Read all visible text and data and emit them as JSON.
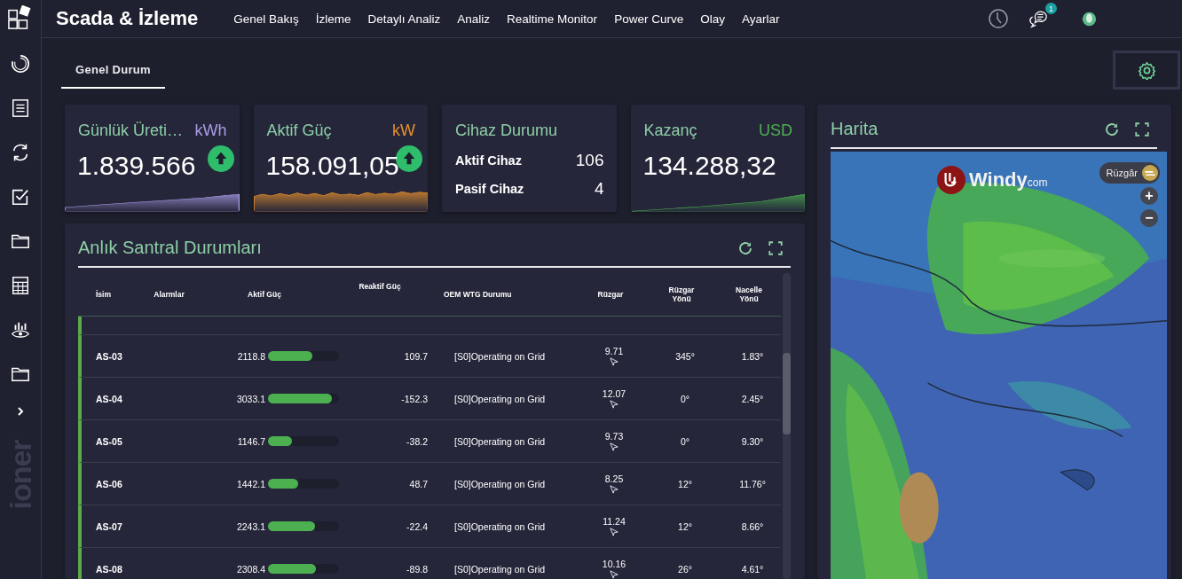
{
  "app": {
    "title": "Scada & İzleme",
    "brand": "ioner"
  },
  "nav": [
    {
      "label": "Genel Bakış"
    },
    {
      "label": "İzleme"
    },
    {
      "label": "Detaylı Analiz"
    },
    {
      "label": "Analiz"
    },
    {
      "label": "Realtime Monitor"
    },
    {
      "label": "Power Curve"
    },
    {
      "label": "Olay"
    },
    {
      "label": "Ayarlar"
    }
  ],
  "header": {
    "notification_count": "1"
  },
  "tabs": [
    {
      "label": "Genel Durum",
      "selected": true
    }
  ],
  "kpis": [
    {
      "kind": "metric",
      "title": "Günlük Üreti…",
      "unit": "kWh",
      "color": "#a99ce6",
      "value": "1.839.566",
      "trend_badge": true
    },
    {
      "kind": "metric",
      "title": "Aktif Güç",
      "unit": "kW",
      "color": "#e8912c",
      "value": "158.091,05",
      "trend_badge": true
    },
    {
      "kind": "devices",
      "title": "Cihaz Durumu",
      "rows": [
        {
          "label": "Aktif Cihaz",
          "value": "106"
        },
        {
          "label": "Pasif Cihaz",
          "value": "4"
        }
      ]
    },
    {
      "kind": "metric",
      "title": "Kazanç",
      "unit": "USD",
      "color": "#4caf50",
      "value": "134.288,32",
      "trend_badge": false
    }
  ],
  "table": {
    "title": "Anlık Santral Durumları",
    "columns": [
      "İsim",
      "Alarmlar",
      "Aktif Güç",
      "Reaktif Güç",
      "OEM WTG Durumu",
      "Rüzgar",
      "Rüzgar Yönü",
      "Nacelle Yönü"
    ],
    "rows": [
      {
        "name": "AS-03",
        "active_power": "2118.8",
        "level": 0.62,
        "reactive_power": "109.7",
        "status": "[S0]Operating on Grid",
        "wind": "9.71",
        "wind_direction": "345°",
        "nacelle_direction": "1.83°"
      },
      {
        "name": "AS-04",
        "active_power": "3033.1",
        "level": 0.9,
        "reactive_power": "-152.3",
        "status": "[S0]Operating on Grid",
        "wind": "12.07",
        "wind_direction": "0°",
        "nacelle_direction": "2.45°"
      },
      {
        "name": "AS-05",
        "active_power": "1146.7",
        "level": 0.34,
        "reactive_power": "-38.2",
        "status": "[S0]Operating on Grid",
        "wind": "9.73",
        "wind_direction": "0°",
        "nacelle_direction": "9.30°"
      },
      {
        "name": "AS-06",
        "active_power": "1442.1",
        "level": 0.43,
        "reactive_power": "48.7",
        "status": "[S0]Operating on Grid",
        "wind": "8.25",
        "wind_direction": "12°",
        "nacelle_direction": "11.76°"
      },
      {
        "name": "AS-07",
        "active_power": "2243.1",
        "level": 0.66,
        "reactive_power": "-22.4",
        "status": "[S0]Operating on Grid",
        "wind": "11.24",
        "wind_direction": "12°",
        "nacelle_direction": "8.66°"
      },
      {
        "name": "AS-08",
        "active_power": "2308.4",
        "level": 0.68,
        "reactive_power": "-89.8",
        "status": "[S0]Operating on Grid",
        "wind": "10.16",
        "wind_direction": "26°",
        "nacelle_direction": "4.61°"
      }
    ]
  },
  "map": {
    "title": "Harita",
    "logo": "Windy",
    "logo_suffix": "com",
    "layer_label": "Rüzgâr",
    "zoom_in": "+",
    "zoom_out": "−"
  }
}
